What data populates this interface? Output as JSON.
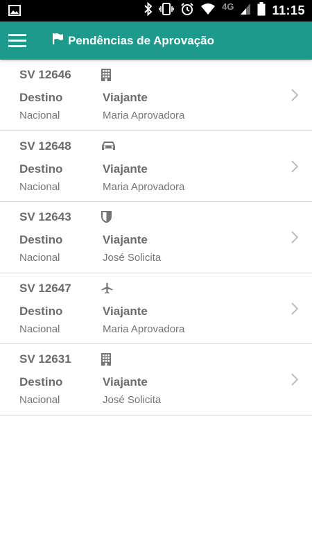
{
  "status_bar": {
    "network": "4G",
    "time": "11:15",
    "icons": [
      "gallery-icon",
      "bluetooth-icon",
      "vibrate-icon",
      "alarm-icon",
      "wifi-icon",
      "signal-icon",
      "battery-icon"
    ]
  },
  "app_bar": {
    "menu_icon": "hamburger-menu-icon",
    "title_icon": "flag-icon",
    "title": "Pendências de Aprovação",
    "color": "#1d9a8c"
  },
  "labels": {
    "destination": "Destino",
    "traveler": "Viajante"
  },
  "items": [
    {
      "id": "SV 12646",
      "type_icon": "hotel-icon",
      "destination": "Nacional",
      "traveler": "Maria Aprovadora"
    },
    {
      "id": "SV 12648",
      "type_icon": "car-icon",
      "destination": "Nacional",
      "traveler": "Maria Aprovadora"
    },
    {
      "id": "SV 12643",
      "type_icon": "insurance-icon",
      "destination": "Nacional",
      "traveler": "José Solicita"
    },
    {
      "id": "SV 12647",
      "type_icon": "airplane-icon",
      "destination": "Nacional",
      "traveler": "Maria Aprovadora"
    },
    {
      "id": "SV 12631",
      "type_icon": "hotel-icon",
      "destination": "Nacional",
      "traveler": "José Solicita"
    }
  ]
}
